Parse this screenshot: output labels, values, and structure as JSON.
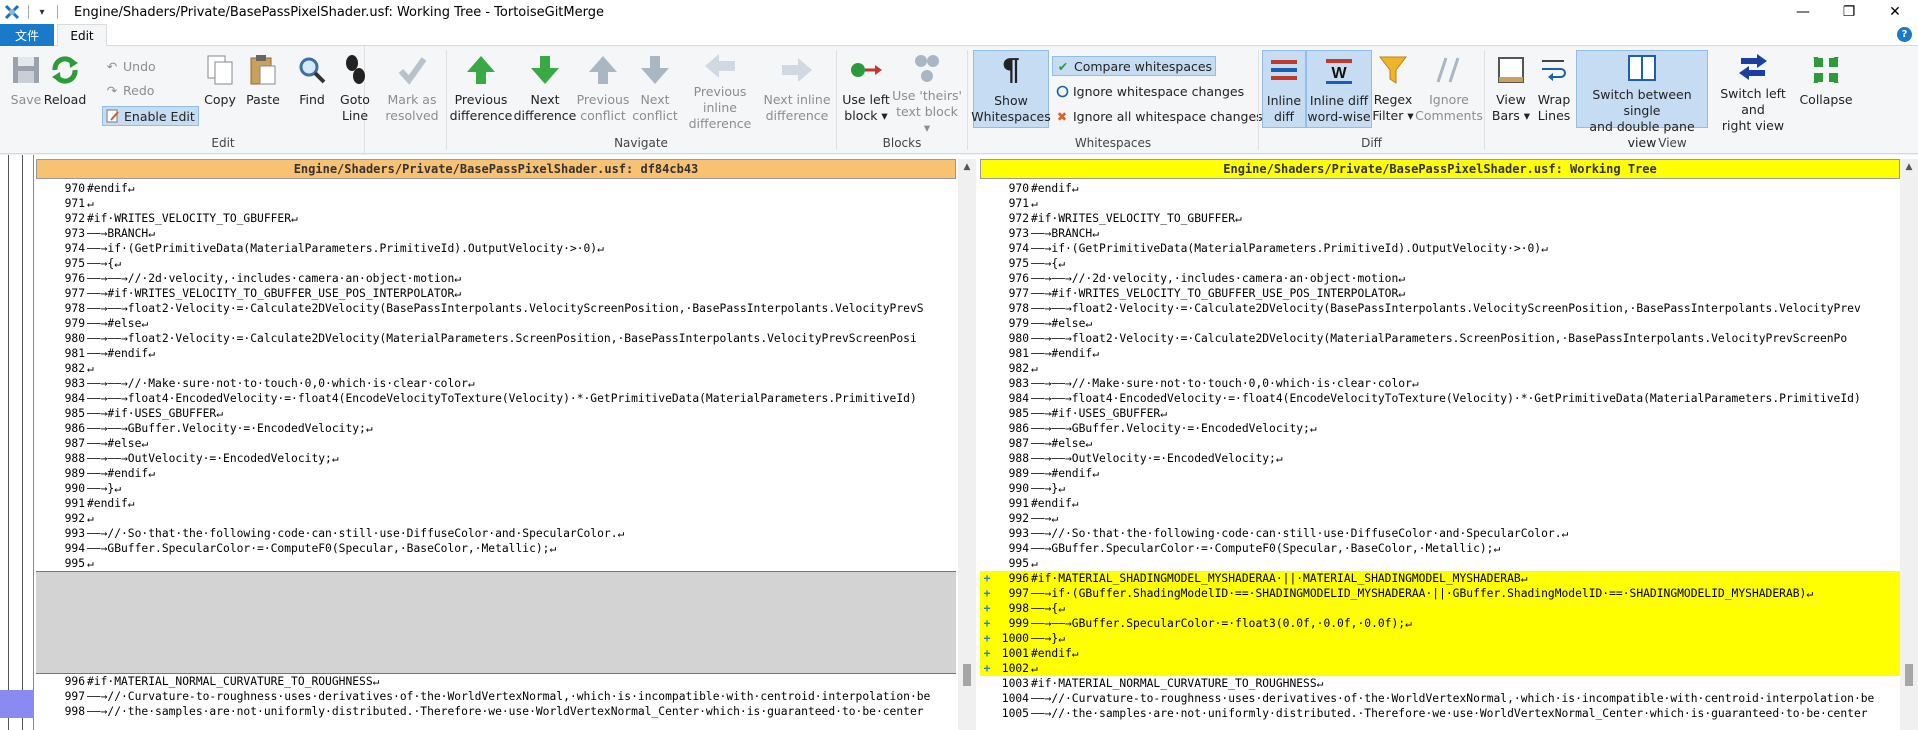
{
  "window": {
    "title": "Engine/Shaders/Private/BasePassPixelShader.usf: Working Tree - TortoiseGitMerge",
    "minimize": "—",
    "maximize": "❐",
    "close": "✕"
  },
  "ribbon_tabs": {
    "file": "文件",
    "edit": "Edit",
    "help": "?"
  },
  "groups": {
    "edit": "Edit",
    "navigate": "Navigate",
    "blocks": "Blocks",
    "whitespaces": "Whitespaces",
    "diff": "Diff",
    "view": "View"
  },
  "buttons": {
    "save": "Save",
    "reload": "Reload",
    "undo": "Undo",
    "redo": "Redo",
    "enable_edit": "Enable Edit",
    "copy": "Copy",
    "paste": "Paste",
    "find": "Find",
    "goto_line_1": "Goto",
    "goto_line_2": "Line",
    "mark_resolved_1": "Mark as",
    "mark_resolved_2": "resolved",
    "prev_diff_1": "Previous",
    "prev_diff_2": "difference",
    "next_diff_1": "Next",
    "next_diff_2": "difference",
    "prev_conflict_1": "Previous",
    "prev_conflict_2": "conflict",
    "next_conflict_1": "Next",
    "next_conflict_2": "conflict",
    "prev_inline_1": "Previous inline",
    "prev_inline_2": "difference",
    "next_inline_1": "Next inline",
    "next_inline_2": "difference",
    "use_left_1": "Use left",
    "use_left_2": "block",
    "use_theirs_1": "Use 'theirs'",
    "use_theirs_2": "text block",
    "show_ws_1": "Show",
    "show_ws_2": "Whitespaces",
    "compare_ws": "Compare whitespaces",
    "ignore_ws_changes": "Ignore whitespace changes",
    "ignore_all_ws": "Ignore all whitespace changes",
    "inline_diff_1": "Inline",
    "inline_diff_2": "diff",
    "inline_word_1": "Inline diff",
    "inline_word_2": "word-wise",
    "regex_1": "Regex",
    "regex_2": "Filter",
    "ignore_comments_1": "Ignore",
    "ignore_comments_2": "Comments",
    "view_bars_1": "View",
    "view_bars_2": "Bars",
    "wrap_lines_1": "Wrap",
    "wrap_lines_2": "Lines",
    "switch_pane_1": "Switch between single",
    "switch_pane_2": "and double pane view",
    "switch_lr_1": "Switch left and",
    "switch_lr_2": "right view",
    "collapse": "Collapse"
  },
  "left_pane": {
    "header": "Engine/Shaders/Private/BasePassPixelShader.usf: df84cb43",
    "lines_top": [
      {
        "n": "970",
        "t": "#endif↵"
      },
      {
        "n": "971",
        "t": "↵"
      },
      {
        "n": "972",
        "t": "#if·WRITES_VELOCITY_TO_GBUFFER↵"
      },
      {
        "n": "973",
        "t": "——→BRANCH↵"
      },
      {
        "n": "974",
        "t": "——→if·(GetPrimitiveData(MaterialParameters.PrimitiveId).OutputVelocity·>·0)↵"
      },
      {
        "n": "975",
        "t": "——→{↵"
      },
      {
        "n": "976",
        "t": "——→——→//·2d·velocity,·includes·camera·an·object·motion↵"
      },
      {
        "n": "977",
        "t": "——→#if·WRITES_VELOCITY_TO_GBUFFER_USE_POS_INTERPOLATOR↵"
      },
      {
        "n": "978",
        "t": "——→——→float2·Velocity·=·Calculate2DVelocity(BasePassInterpolants.VelocityScreenPosition,·BasePassInterpolants.VelocityPrevS"
      },
      {
        "n": "979",
        "t": "——→#else↵"
      },
      {
        "n": "980",
        "t": "——→——→float2·Velocity·=·Calculate2DVelocity(MaterialParameters.ScreenPosition,·BasePassInterpolants.VelocityPrevScreenPosi"
      },
      {
        "n": "981",
        "t": "——→#endif↵"
      },
      {
        "n": "982",
        "t": "↵"
      },
      {
        "n": "983",
        "t": "——→——→//·Make·sure·not·to·touch·0,0·which·is·clear·color↵"
      },
      {
        "n": "984",
        "t": "——→——→float4·EncodedVelocity·=·float4(EncodeVelocityToTexture(Velocity)·*·GetPrimitiveData(MaterialParameters.PrimitiveId)"
      },
      {
        "n": "985",
        "t": "——→#if·USES_GBUFFER↵"
      },
      {
        "n": "986",
        "t": "——→——→GBuffer.Velocity·=·EncodedVelocity;↵"
      },
      {
        "n": "987",
        "t": "——→#else↵"
      },
      {
        "n": "988",
        "t": "——→——→OutVelocity·=·EncodedVelocity;↵"
      },
      {
        "n": "989",
        "t": "——→#endif↵"
      },
      {
        "n": "990",
        "t": "——→}↵"
      },
      {
        "n": "991",
        "t": "#endif↵"
      },
      {
        "n": "992",
        "t": "↵"
      },
      {
        "n": "993",
        "t": "——→//·So·that·the·following·code·can·still·use·DiffuseColor·and·SpecularColor.↵"
      },
      {
        "n": "994",
        "t": "——→GBuffer.SpecularColor·=·ComputeF0(Specular,·BaseColor,·Metallic);↵"
      },
      {
        "n": "995",
        "t": "↵"
      }
    ],
    "lines_bottom": [
      {
        "n": "996",
        "t": "#if·MATERIAL_NORMAL_CURVATURE_TO_ROUGHNESS↵"
      },
      {
        "n": "997",
        "t": "——→//·Curvature-to-roughness·uses·derivatives·of·the·WorldVertexNormal,·which·is·incompatible·with·centroid·interpolation·be"
      },
      {
        "n": "998",
        "t": "——→//·the·samples·are·not·uniformly·distributed.·Therefore·we·use·WorldVertexNormal_Center·which·is·guaranteed·to·be·center"
      }
    ]
  },
  "right_pane": {
    "header": "Engine/Shaders/Private/BasePassPixelShader.usf: Working Tree",
    "lines_top": [
      {
        "n": "970",
        "t": "#endif↵"
      },
      {
        "n": "971",
        "t": "↵"
      },
      {
        "n": "972",
        "t": "#if·WRITES_VELOCITY_TO_GBUFFER↵"
      },
      {
        "n": "973",
        "t": "——→BRANCH↵"
      },
      {
        "n": "974",
        "t": "——→if·(GetPrimitiveData(MaterialParameters.PrimitiveId).OutputVelocity·>·0)↵"
      },
      {
        "n": "975",
        "t": "——→{↵"
      },
      {
        "n": "976",
        "t": "——→——→//·2d·velocity,·includes·camera·an·object·motion↵"
      },
      {
        "n": "977",
        "t": "——→#if·WRITES_VELOCITY_TO_GBUFFER_USE_POS_INTERPOLATOR↵"
      },
      {
        "n": "978",
        "t": "——→——→float2·Velocity·=·Calculate2DVelocity(BasePassInterpolants.VelocityScreenPosition,·BasePassInterpolants.VelocityPrev"
      },
      {
        "n": "979",
        "t": "——→#else↵"
      },
      {
        "n": "980",
        "t": "——→——→float2·Velocity·=·Calculate2DVelocity(MaterialParameters.ScreenPosition,·BasePassInterpolants.VelocityPrevScreenPo"
      },
      {
        "n": "981",
        "t": "——→#endif↵"
      },
      {
        "n": "982",
        "t": "↵"
      },
      {
        "n": "983",
        "t": "——→——→//·Make·sure·not·to·touch·0,0·which·is·clear·color↵"
      },
      {
        "n": "984",
        "t": "——→——→float4·EncodedVelocity·=·float4(EncodeVelocityToTexture(Velocity)·*·GetPrimitiveData(MaterialParameters.PrimitiveId)"
      },
      {
        "n": "985",
        "t": "——→#if·USES_GBUFFER↵"
      },
      {
        "n": "986",
        "t": "——→——→GBuffer.Velocity·=·EncodedVelocity;↵"
      },
      {
        "n": "987",
        "t": "——→#else↵"
      },
      {
        "n": "988",
        "t": "——→——→OutVelocity·=·EncodedVelocity;↵"
      },
      {
        "n": "989",
        "t": "——→#endif↵"
      },
      {
        "n": "990",
        "t": "——→}↵"
      },
      {
        "n": "991",
        "t": "#endif↵"
      },
      {
        "n": "992",
        "t": "——→↵"
      },
      {
        "n": "993",
        "t": "——→//·So·that·the·following·code·can·still·use·DiffuseColor·and·SpecularColor.↵"
      },
      {
        "n": "994",
        "t": "——→GBuffer.SpecularColor·=·ComputeF0(Specular,·BaseColor,·Metallic);↵"
      },
      {
        "n": "995",
        "t": "↵"
      }
    ],
    "lines_added": [
      {
        "g": "+",
        "n": "996",
        "t": "#if·MATERIAL_SHADINGMODEL_MYSHADERAA·||·MATERIAL_SHADINGMODEL_MYSHADERAB↵"
      },
      {
        "g": "+",
        "n": "997",
        "t": "——→if·(GBuffer.ShadingModelID·==·SHADINGMODELID_MYSHADERAA·||·GBuffer.ShadingModelID·==·SHADINGMODELID_MYSHADERAB)↵"
      },
      {
        "g": "+",
        "n": "998",
        "t": "——→{↵"
      },
      {
        "g": "+",
        "n": "999",
        "t": "——→——→GBuffer.SpecularColor·=·float3(0.0f,·0.0f,·0.0f);↵"
      },
      {
        "g": "+",
        "n": "1000",
        "t": "——→}↵"
      },
      {
        "g": "+",
        "n": "1001",
        "t": "#endif↵"
      },
      {
        "g": "+",
        "n": "1002",
        "t": "↵"
      }
    ],
    "lines_bottom": [
      {
        "n": "1003",
        "t": "#if·MATERIAL_NORMAL_CURVATURE_TO_ROUGHNESS↵"
      },
      {
        "n": "1004",
        "t": "——→//·Curvature-to-roughness·uses·derivatives·of·the·WorldVertexNormal,·which·is·incompatible·with·centroid·interpolation·be"
      },
      {
        "n": "1005",
        "t": "——→//·the·samples·are·not·uniformly·distributed.·Therefore·we·use·WorldVertexNormal_Center·which·is·guaranteed·to·be·center"
      }
    ]
  },
  "colors": {
    "left_header": "#f9c272",
    "right_header": "#ffff00",
    "added_lines": "#ffff00",
    "empty_block": "#d3d3d3",
    "accent": "#1979ca"
  }
}
